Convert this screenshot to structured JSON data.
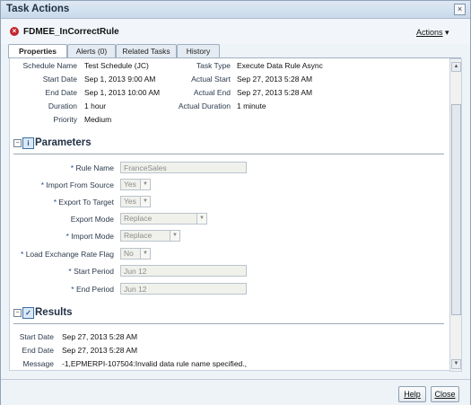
{
  "window": {
    "title": "Task Actions",
    "close_glyph": "×"
  },
  "task": {
    "name": "FDMEE_InCorrectRule",
    "status_icon": "error-icon",
    "actions_label": "Actions"
  },
  "tabs": [
    {
      "label": "Properties",
      "active": true
    },
    {
      "label": "Alerts (0)"
    },
    {
      "label": "Related Tasks"
    },
    {
      "label": "History"
    }
  ],
  "properties": {
    "left": [
      {
        "label": "Schedule Name",
        "value": "Test Schedule (JC)"
      },
      {
        "label": "Start Date",
        "value": "Sep 1, 2013 9:00 AM"
      },
      {
        "label": "End Date",
        "value": "Sep 1, 2013 10:00 AM"
      },
      {
        "label": "Duration",
        "value": "1 hour"
      },
      {
        "label": "Priority",
        "value": "Medium"
      }
    ],
    "right": [
      {
        "label": "Task Type",
        "value": "Execute Data Rule Async"
      },
      {
        "label": "Actual Start",
        "value": "Sep 27, 2013 5:28 AM"
      },
      {
        "label": "Actual End",
        "value": "Sep 27, 2013 5:28 AM"
      },
      {
        "label": "Actual Duration",
        "value": "1 minute"
      }
    ]
  },
  "parameters": {
    "title": "Parameters",
    "fields": [
      {
        "label": "Rule Name",
        "value": "FranceSales",
        "required": "*"
      },
      {
        "label": "Import From Source",
        "value": "Yes",
        "required": "*"
      },
      {
        "label": "Export To Target",
        "value": "Yes",
        "required": "*"
      },
      {
        "label": "Export Mode",
        "value": "Replace",
        "required": ""
      },
      {
        "label": "Import Mode",
        "value": "Replace",
        "required": "*"
      },
      {
        "label": "Load Exchange Rate Flag",
        "value": "No",
        "required": "*"
      },
      {
        "label": "Start Period",
        "value": "Jun 12",
        "required": "*"
      },
      {
        "label": "End Period",
        "value": "Jun 12",
        "required": "*"
      }
    ]
  },
  "results": {
    "title": "Results",
    "rows": [
      {
        "label": "Start Date",
        "value": "Sep 27, 2013 5:28 AM"
      },
      {
        "label": "End Date",
        "value": "Sep 27, 2013 5:28 AM"
      },
      {
        "label": "Message",
        "value": "-1,EPMERPI-107504:Invalid data rule name specified.,"
      }
    ]
  },
  "footer": {
    "help": "Help",
    "close": "Close"
  }
}
